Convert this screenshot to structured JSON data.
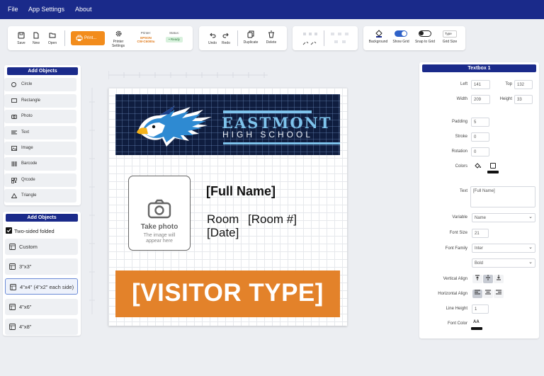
{
  "menu": [
    "File",
    "App Settings",
    "About"
  ],
  "toolbar": {
    "save": "Save",
    "new": "New",
    "open": "Open",
    "print": "Print...",
    "printer_settings": "Printer Settings",
    "printer_title": "Printer:",
    "printer_line1": "EPSON",
    "printer_line2": "CW-C6000u",
    "status_title": "Status:",
    "status_value": "• Ready",
    "undo": "Undo",
    "redo": "Redo",
    "duplicate": "Duplicate",
    "delete": "Delete",
    "background": "Background",
    "show_grid": "Show Grid",
    "snap_to_grid": "Snap to Grid",
    "grid_size_value": "Type",
    "grid_size": "Grid Size"
  },
  "add_objects": {
    "title": "Add Objects",
    "items": [
      "Circle",
      "Rectangle",
      "Photo",
      "Text",
      "Image",
      "Barcode",
      "Qrcode",
      "Triangle"
    ]
  },
  "sizes": {
    "title": "Add Objects",
    "two_sided": "Two-sided folded",
    "items": [
      "Custom",
      "3\"x3\"",
      "4\"x4\" (4\"x2\" each side)",
      "4\"x6\"",
      "4\"x8\""
    ]
  },
  "badge": {
    "school_name": "EASTMONT",
    "school_sub": "HIGH SCHOOL",
    "photo_title": "Take photo",
    "photo_hint": "The image will appear here",
    "full_name": "[Full Name]",
    "room_label": "Room",
    "room_value": "[Room #]",
    "date": "[Date]",
    "visitor_type": "[VISITOR TYPE]"
  },
  "props": {
    "title": "Textbox 1",
    "left_label": "Left",
    "left": "141",
    "top_label": "Top",
    "top": "132",
    "width_label": "Width",
    "width": "209",
    "height_label": "Height",
    "height": "33",
    "padding_label": "Padding",
    "padding": "5",
    "stroke_label": "Stroke",
    "stroke": "0",
    "rotation_label": "Rotation",
    "rotation": "0",
    "colors_label": "Colors",
    "text_label": "Text",
    "text": "[Full Name]",
    "variable_label": "Variable",
    "variable": "Name",
    "font_size_label": "Font Size",
    "font_size": "21",
    "font_family_label": "Font Family",
    "font_family": "Inter",
    "font_weight": "Bold",
    "valign_label": "Vertical Align",
    "halign_label": "Horizontal Align",
    "line_height_label": "Line Height",
    "line_height": "1",
    "font_color_label": "Font Color",
    "font_color_glyph": "AA"
  },
  "colors": {
    "menubar": "#1a2a8a",
    "print_button": "#f28c1c",
    "banner": "#0f1d3f",
    "school_text": "#7ec3ec",
    "visitor_band": "#e3822a",
    "toggle_on": "#2f62c8"
  }
}
